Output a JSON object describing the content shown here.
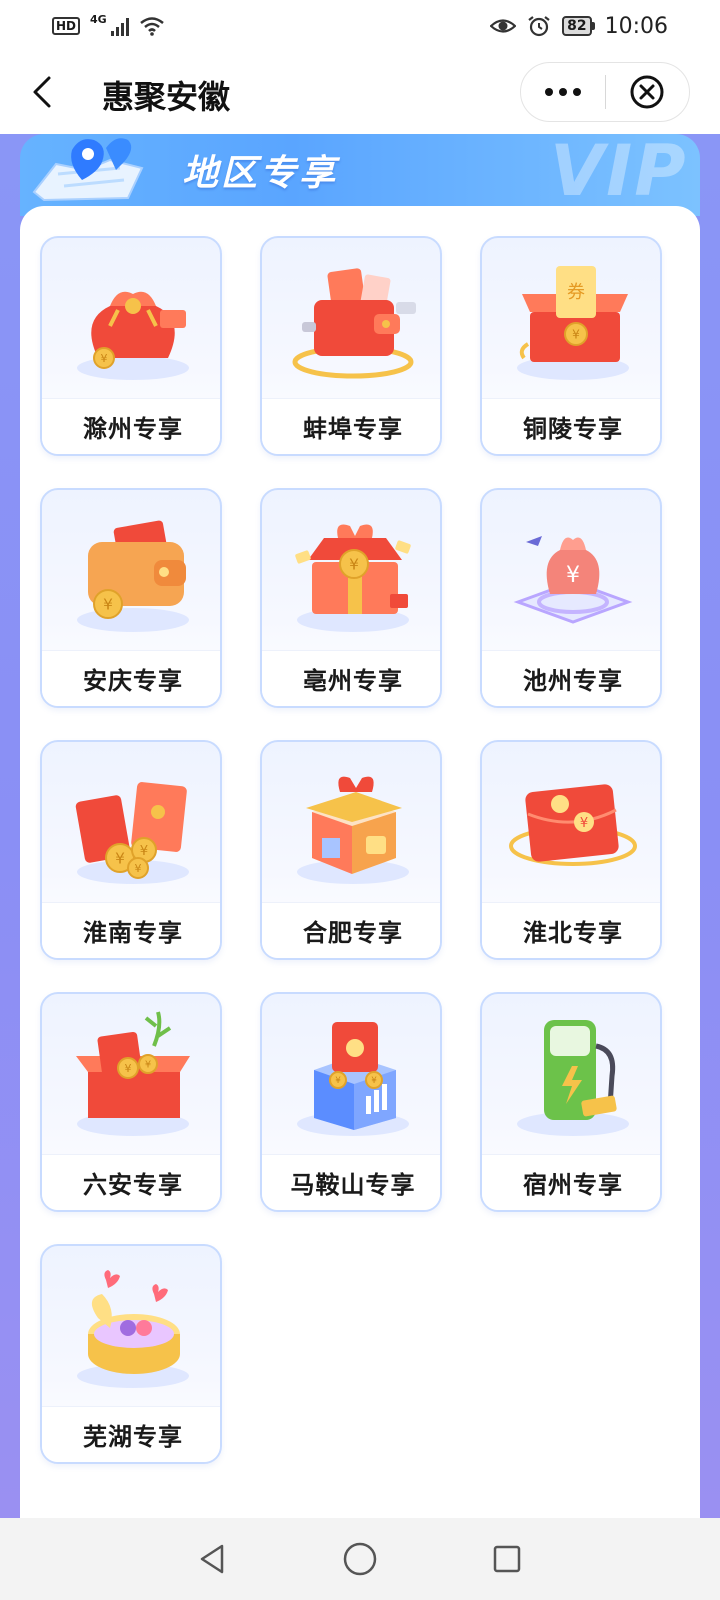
{
  "status_bar": {
    "hd_label": "HD",
    "network_label": "4G",
    "battery_level": "82",
    "time": "10:06"
  },
  "title_bar": {
    "title": "惠聚安徽"
  },
  "section": {
    "title": "地区专享",
    "watermark": "VIP"
  },
  "tiles": [
    {
      "label": "滁州专享",
      "icon": "money-bag-icon"
    },
    {
      "label": "蚌埠专享",
      "icon": "wallet-card-icon"
    },
    {
      "label": "铜陵专享",
      "icon": "coupon-box-icon"
    },
    {
      "label": "安庆专享",
      "icon": "wallet-coin-icon"
    },
    {
      "label": "亳州专享",
      "icon": "gift-box-icon"
    },
    {
      "label": "池州专享",
      "icon": "yuan-bag-platform-icon"
    },
    {
      "label": "淮南专享",
      "icon": "red-envelope-coins-icon"
    },
    {
      "label": "合肥专享",
      "icon": "gift-shop-icon"
    },
    {
      "label": "淮北专享",
      "icon": "red-envelope-yuan-icon"
    },
    {
      "label": "六安专享",
      "icon": "red-box-envelopes-icon"
    },
    {
      "label": "马鞍山专享",
      "icon": "envelope-building-icon"
    },
    {
      "label": "宿州专享",
      "icon": "charging-station-icon"
    },
    {
      "label": "芜湖专享",
      "icon": "hearts-gift-box-icon"
    }
  ],
  "colors": {
    "page_bg": "#8a96f6",
    "header_blue": "#5aa5ff",
    "tile_border": "#c8dbff",
    "accent_red": "#f04a3a",
    "accent_gold": "#f6c24a"
  }
}
